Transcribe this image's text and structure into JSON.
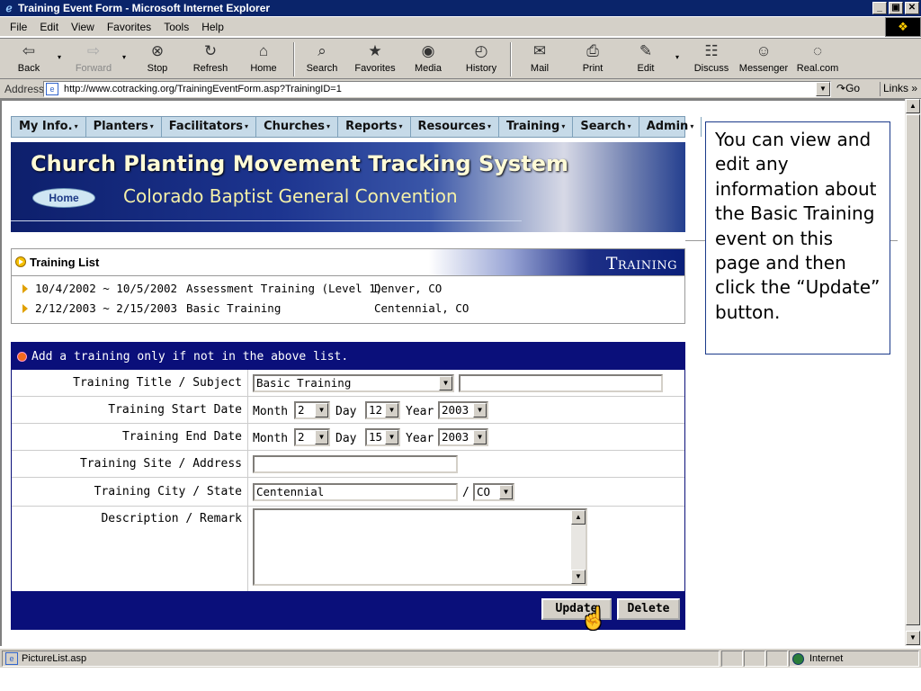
{
  "window": {
    "title": "Training Event Form - Microsoft Internet Explorer"
  },
  "menu": [
    "File",
    "Edit",
    "View",
    "Favorites",
    "Tools",
    "Help"
  ],
  "toolbar": {
    "back": "Back",
    "forward": "Forward",
    "stop": "Stop",
    "refresh": "Refresh",
    "home": "Home",
    "search": "Search",
    "favorites": "Favorites",
    "media": "Media",
    "history": "History",
    "mail": "Mail",
    "print": "Print",
    "edit": "Edit",
    "discuss": "Discuss",
    "messenger": "Messenger",
    "real": "Real.com"
  },
  "address": {
    "label": "Address",
    "url": "http://www.cotracking.org/TrainingEventForm.asp?TrainingID=1",
    "go": "Go",
    "links": "Links"
  },
  "nav": [
    "My Info.",
    "Planters",
    "Facilitators",
    "Churches",
    "Reports",
    "Resources",
    "Training",
    "Search",
    "Admin"
  ],
  "banner": {
    "title": "Church Planting Movement Tracking System",
    "subtitle": "Colorado Baptist General Convention",
    "home": "Home"
  },
  "training_list": {
    "heading": "Training List",
    "logo": "Training",
    "items": [
      {
        "dates": "10/4/2002 ~ 10/5/2002",
        "name": "Assessment Training (Level 1)",
        "place": "Denver, CO"
      },
      {
        "dates": "2/12/2003 ~ 2/15/2003",
        "name": "Basic Training",
        "place": "Centennial, CO"
      }
    ]
  },
  "form": {
    "header": "Add a training only if not in the above list.",
    "labels": {
      "title": "Training Title / Subject",
      "start": "Training Start Date",
      "end": "Training End Date",
      "site": "Training Site / Address",
      "city": "Training City / State",
      "desc": "Description / Remark"
    },
    "title_select": "Basic Training",
    "title_other": "",
    "month_label": "Month",
    "day_label": "Day",
    "year_label": "Year",
    "start": {
      "month": "2",
      "day": "12",
      "year": "2003"
    },
    "end": {
      "month": "2",
      "day": "15",
      "year": "2003"
    },
    "site": "",
    "city": "Centennial",
    "slash": "/",
    "state": "CO",
    "description": "",
    "update": "Update",
    "delete": "Delete"
  },
  "callout": "You can view and edit any information about the Basic Training event on this page and then click the “Update” button.",
  "status": {
    "text": "PictureList.asp",
    "zone": "Internet"
  }
}
